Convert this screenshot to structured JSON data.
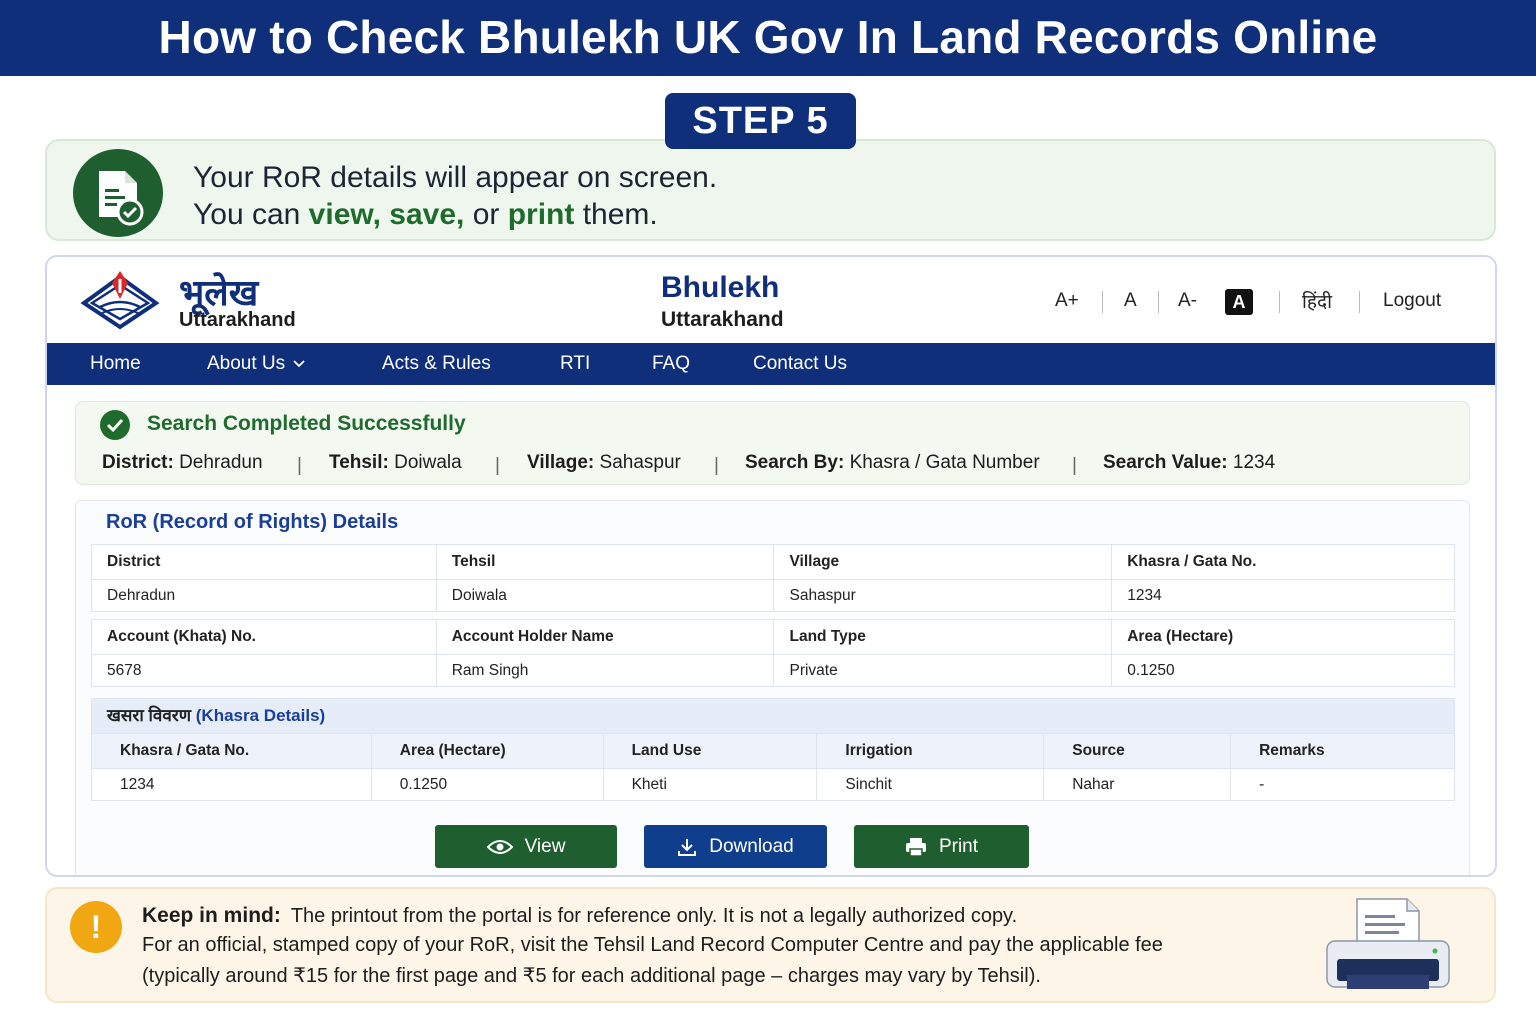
{
  "banner": {
    "title": "How to Check Bhulekh UK Gov In Land Records Online"
  },
  "step": {
    "label": "STEP 5"
  },
  "intro": {
    "line1": "Your RoR details will appear on screen.",
    "line2_a": "You can ",
    "line2_view": "view, ",
    "line2_save": "save,",
    "line2_b": " or ",
    "line2_print": "print",
    "line2_c": " them."
  },
  "header": {
    "brand_hindi": "भूलेख",
    "brand_state": "Uttarakhand",
    "center_title": "Bhulekh",
    "center_sub": "Uttarakhand",
    "font_larger": "A+",
    "font_normal": "A",
    "font_smaller": "A-",
    "contrast": "A",
    "hindi_toggle": "हिंदी",
    "logout": "Logout"
  },
  "nav": {
    "items": [
      "Home",
      "About Us",
      "Acts & Rules",
      "RTI",
      "FAQ",
      "Contact Us"
    ]
  },
  "status": {
    "title": "Search Completed Successfully",
    "district_label": "District:",
    "district_value": "Dehradun",
    "tehsil_label": "Tehsil:",
    "tehsil_value": "Doiwala",
    "village_label": "Village:",
    "village_value": "Sahaspur",
    "search_by_label": "Search By:",
    "search_by_value": "Khasra / Gata Number",
    "search_value_label": "Search Value:",
    "search_value_value": "1234",
    "separator": "|"
  },
  "ror": {
    "title": "RoR (Record of Rights) Details",
    "row1_headers": [
      "District",
      "Tehsil",
      "Village",
      "Khasra / Gata No."
    ],
    "row1_values": [
      "Dehradun",
      "Doiwala",
      "Sahaspur",
      "1234"
    ],
    "row2_headers": [
      "Account (Khata) No.",
      "Account Holder Name",
      "Land Type",
      "Area (Hectare)"
    ],
    "row2_values": [
      "5678",
      "Ram Singh",
      "Private",
      "0.1250"
    ]
  },
  "khasra": {
    "title_hindi": "खसरा विवरण",
    "title_en": "(Khasra Details)",
    "headers": [
      "Khasra / Gata No.",
      "Area (Hectare)",
      "Land Use",
      "Irrigation",
      "Source",
      "Remarks"
    ],
    "values": [
      "1234",
      "0.1250",
      "Kheti",
      "Sinchit",
      "Nahar",
      "-"
    ]
  },
  "actions": {
    "view": "View",
    "download": "Download",
    "print": "Print"
  },
  "note": {
    "label": "Keep in mind:",
    "line1": "The printout from the portal is for reference only. It is not a legally authorized copy.",
    "line2": "For an official, stamped copy of your RoR, visit the Tehsil Land Record Computer Centre and pay the applicable fee",
    "line3": "(typically around ₹15 for the first page and ₹5 for each additional page – charges may vary by Tehsil)."
  },
  "colors": {
    "navy": "#0f2f7a",
    "green": "#1e6b2c",
    "amber": "#f0a712"
  }
}
